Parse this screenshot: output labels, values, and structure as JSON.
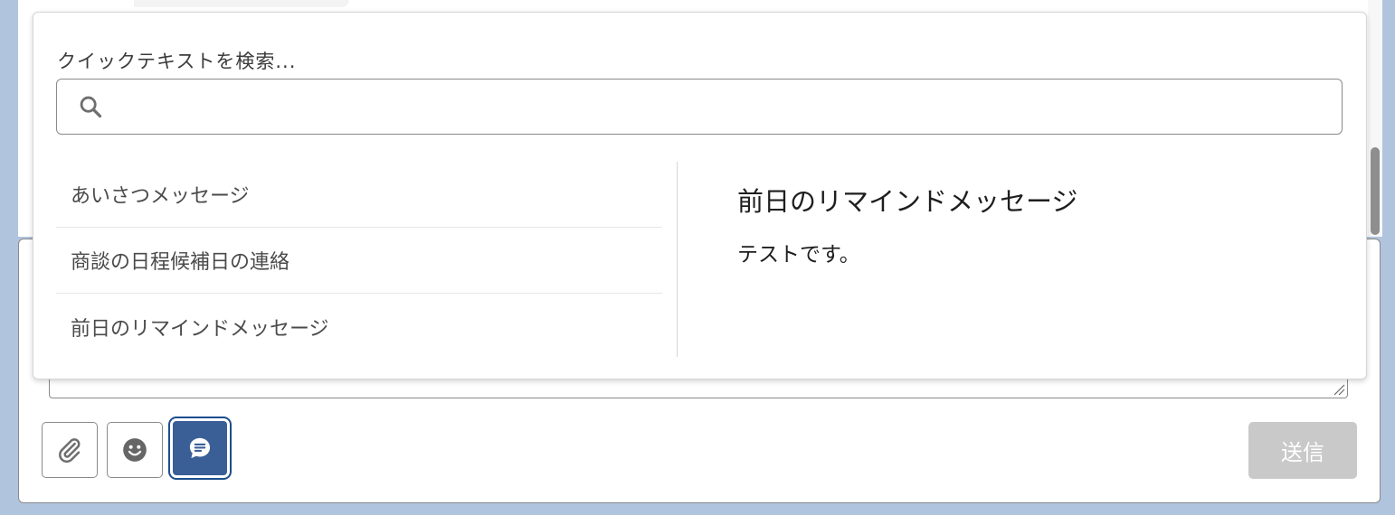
{
  "quick_text": {
    "search_label": "クイックテキストを検索...",
    "search_value": "",
    "items": [
      {
        "label": "あいさつメッセージ"
      },
      {
        "label": "商談の日程候補日の連絡"
      },
      {
        "label": "前日のリマインドメッセージ"
      }
    ],
    "preview": {
      "title": "前日のリマインドメッセージ",
      "body": "テストです。"
    }
  },
  "composer": {
    "message_value": "",
    "toolbar": [
      {
        "icon": "paperclip-icon",
        "state": "default"
      },
      {
        "icon": "smiley-icon",
        "state": "default"
      },
      {
        "icon": "chat-bubble-icon",
        "state": "active"
      }
    ],
    "send_label": "送信"
  },
  "colors": {
    "page_background": "#b0c4de",
    "active_button": "#3a5f97",
    "active_outline": "#1c4d8c",
    "send_disabled": "#c9c9c9"
  }
}
